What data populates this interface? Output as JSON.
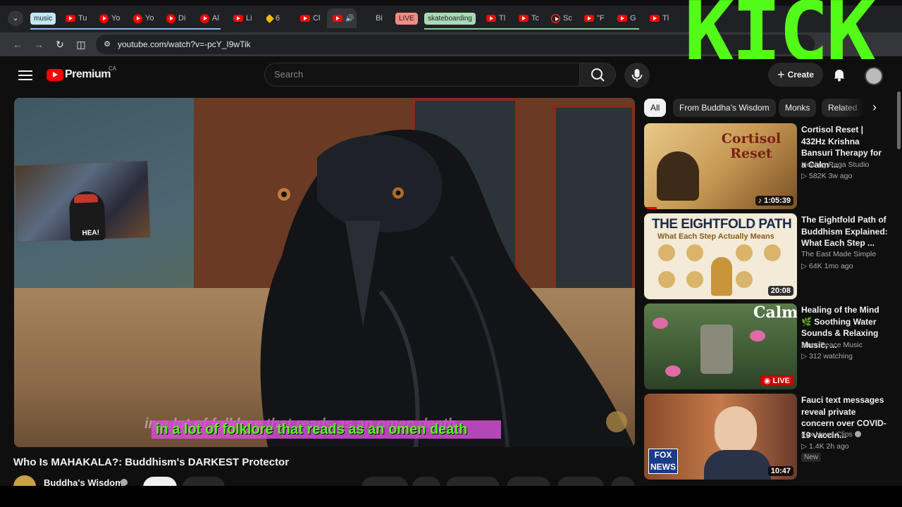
{
  "browser": {
    "tabs": [
      {
        "label": "Tu",
        "icon": "youtube-icon"
      },
      {
        "label": "Yo",
        "icon": "youtube-music-icon"
      },
      {
        "label": "Yo",
        "icon": "youtube-music-icon"
      },
      {
        "label": "Di",
        "icon": "youtube-music-icon"
      },
      {
        "label": "Al",
        "icon": "youtube-music-icon"
      },
      {
        "label": "Li",
        "icon": "youtube-icon"
      },
      {
        "label": "6",
        "icon": "binance-icon"
      },
      {
        "label": "Cl",
        "icon": "youtube-icon"
      },
      {
        "label": "",
        "icon": "youtube-icon"
      },
      {
        "label": "Bi",
        "icon": "kick-icon"
      },
      {
        "label": "Tl",
        "icon": "youtube-icon"
      },
      {
        "label": "Tc",
        "icon": "youtube-icon"
      },
      {
        "label": "Sc",
        "icon": "youtube-music-icon"
      },
      {
        "label": "\"F",
        "icon": "youtube-icon"
      },
      {
        "label": "G",
        "icon": "youtube-icon"
      },
      {
        "label": "Tl",
        "icon": "youtube-icon"
      }
    ],
    "tab_groups": {
      "music": "music",
      "live": "LIVE",
      "skateboarding": "skateboarding"
    },
    "url": "youtube.com/watch?v=-pcY_I9wTik",
    "overlay_text": "KICK"
  },
  "youtube": {
    "logo_text": "Premium",
    "country": "CA",
    "search_placeholder": "Search",
    "create_label": "Create"
  },
  "video": {
    "caption": "in a lot of folklore that reads as an omen death",
    "ghost_caption": "in a lot of folklore that reads as an omen death",
    "title": "Who Is MAHAKALA?: Buddhism's DARKEST Protector",
    "channel": "Buddha's Wisdom",
    "pip_label": "HEA!"
  },
  "chips": [
    "All",
    "From Buddha's Wisdom",
    "Monks",
    "Related"
  ],
  "recommendations": [
    {
      "title": "Cortisol Reset | 432Hz Krishna Bansuri Therapy for a Calm ...",
      "channel": "Healing Raga Studio",
      "meta": "582K  3w ago",
      "duration": "1:05:39",
      "thumb_text": "Cortisol Reset"
    },
    {
      "title": "The Eightfold Path of Buddhism Explained: What Each Step ...",
      "channel": "The East Made Simple",
      "meta": "64K  1mo ago",
      "duration": "20:08",
      "thumb_text": "THE EIGHTFOLD PATH",
      "thumb_subtext": "What Each Step Actually Means"
    },
    {
      "title": "Healing of the Mind 🌿 Soothing Water Sounds & Relaxing Music, ...",
      "channel": "Inner Peace Music",
      "meta": "312 watching",
      "live_label": "LIVE",
      "thumb_text": "Calm"
    },
    {
      "title": "Fauci text messages reveal private concern over COVID-19 vaccin...",
      "channel": "Fox News Clips",
      "meta": "1.4K  2h ago",
      "duration": "10:47",
      "badge": "New",
      "thumb_text": "FOX NEWS"
    }
  ]
}
